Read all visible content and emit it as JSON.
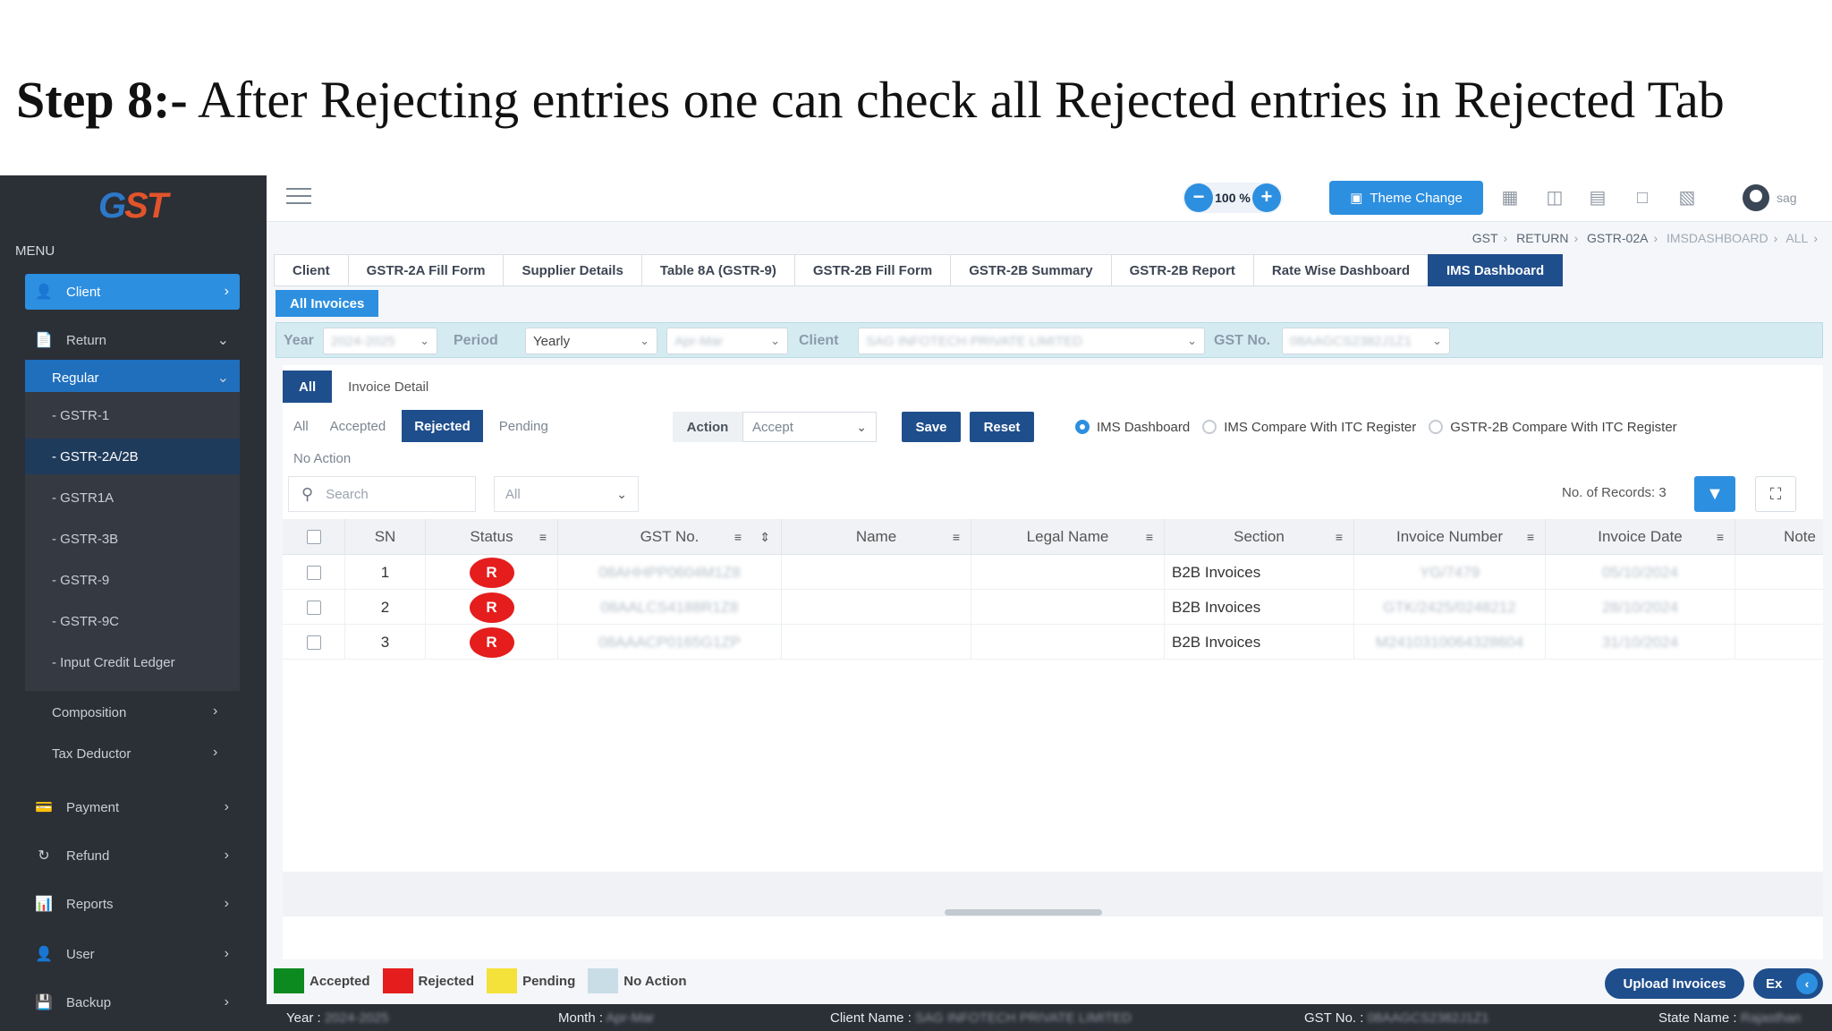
{
  "headline": {
    "step": "Step 8:-",
    "text": "After Rejecting entries one can check all Rejected entries in Rejected Tab"
  },
  "sidebar": {
    "logo_main": "G",
    "logo_accent": "ST",
    "menu_label": "MENU",
    "items": [
      {
        "label": "Client",
        "icon": "user-icon"
      },
      {
        "label": "Return",
        "icon": "document-icon"
      },
      {
        "label": "Regular"
      }
    ],
    "sub_items": [
      "- GSTR-1",
      "- GSTR-2A/2B",
      "- GSTR1A",
      "- GSTR-3B",
      "- GSTR-9",
      "- GSTR-9C",
      "- Input Credit Ledger"
    ],
    "plain_items": [
      "Composition",
      "Tax Deductor"
    ],
    "bottom_items": [
      {
        "label": "Payment",
        "icon": "payment-icon"
      },
      {
        "label": "Refund",
        "icon": "refund-icon"
      },
      {
        "label": "Reports",
        "icon": "reports-icon"
      },
      {
        "label": "User",
        "icon": "user-icon"
      },
      {
        "label": "Backup",
        "icon": "backup-icon"
      }
    ]
  },
  "topbar": {
    "zoom_minus": "−",
    "zoom_value": "100 %",
    "zoom_plus": "+",
    "theme_label": "Theme Change",
    "user_name": "sag"
  },
  "breadcrumb": [
    "GST",
    "RETURN",
    "GSTR-02A",
    "IMSDASHBOARD",
    "ALL"
  ],
  "tabs": [
    "Client",
    "GSTR-2A Fill Form",
    "Supplier Details",
    "Table 8A (GSTR-9)",
    "GSTR-2B Fill Form",
    "GSTR-2B Summary",
    "GSTR-2B Report",
    "Rate Wise Dashboard",
    "IMS Dashboard"
  ],
  "all_invoices": "All Invoices",
  "filters": {
    "year_label": "Year",
    "year_value": "2024-2025",
    "period_label": "Period",
    "period_value": "Yearly",
    "month_value": "Apr-Mar",
    "client_label": "Client",
    "client_value": "SAG INFOTECH PRIVATE LIMITED",
    "gst_label": "GST No.",
    "gst_value": "08AAGCS2382J1Z1"
  },
  "segment": [
    "All",
    "Invoice Detail"
  ],
  "subtabs": [
    "All",
    "Accepted",
    "Rejected",
    "Pending"
  ],
  "no_action": "No Action",
  "action": {
    "label": "Action",
    "value": "Accept",
    "save": "Save",
    "reset": "Reset"
  },
  "radios": [
    "IMS Dashboard",
    "IMS Compare With ITC Register",
    "GSTR-2B Compare With ITC Register"
  ],
  "search": {
    "placeholder": "Search",
    "filter_value": "All"
  },
  "records": "No. of Records: 3",
  "table": {
    "columns": [
      "SN",
      "Status",
      "GST No.",
      "Name",
      "Legal Name",
      "Section",
      "Invoice Number",
      "Invoice Date",
      "Note"
    ],
    "rows": [
      {
        "sn": "1",
        "status": "R",
        "gst": "08AHHPP0604M1Z8",
        "section": "B2B Invoices",
        "inv": "YG/7479",
        "date": "05/10/2024"
      },
      {
        "sn": "2",
        "status": "R",
        "gst": "08AALCS4188R1Z8",
        "section": "B2B Invoices",
        "inv": "GTK/2425/0248212",
        "date": "28/10/2024"
      },
      {
        "sn": "3",
        "status": "R",
        "gst": "08AAACP0165G1ZP",
        "section": "B2B Invoices",
        "inv": "M2410310064328604",
        "date": "31/10/2024"
      }
    ]
  },
  "legend": [
    {
      "label": "Accepted",
      "color": "#0c8a1f"
    },
    {
      "label": "Rejected",
      "color": "#e51d1d"
    },
    {
      "label": "Pending",
      "color": "#f4e23a"
    },
    {
      "label": "No Action",
      "color": "#c9dde6"
    }
  ],
  "buttons": {
    "upload": "Upload Invoices",
    "ex": "Ex"
  },
  "statusbar": {
    "year_label": "Year :",
    "year_value": "2024-2025",
    "month_label": "Month :",
    "month_value": "Apr-Mar",
    "client_label": "Client Name :",
    "client_value": "SAG INFOTECH PRIVATE LIMITED",
    "gst_label": "GST No. :",
    "gst_value": "08AAGCS2382J1Z1",
    "state_label": "State Name :",
    "state_value": "Rajasthan"
  }
}
